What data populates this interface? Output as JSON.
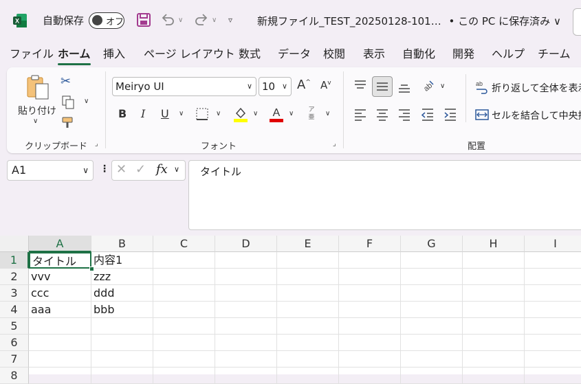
{
  "titlebar": {
    "autosave_label": "自動保存",
    "toggle_label": "オフ",
    "doc_title": "新規ファイル_TEST_20250128-101…",
    "save_state": "• この PC に保存済み ∨"
  },
  "menu_tabs": [
    "ファイル",
    "ホーム",
    "挿入",
    "ページ レイアウト",
    "数式",
    "データ",
    "校閲",
    "表示",
    "自動化",
    "開発",
    "ヘルプ",
    "チーム"
  ],
  "ribbon": {
    "clipboard": {
      "paste_label": "貼り付け",
      "group_label": "クリップボード"
    },
    "font": {
      "font_name": "Meiryo UI",
      "font_size": "10",
      "group_label": "フォント",
      "bold": "B",
      "italic": "I",
      "underline": "U",
      "furigana": "ア亜"
    },
    "alignment": {
      "wrap_label": "折り返して全体を表示",
      "merge_label": "セルを結合して中央揃",
      "group_label": "配置"
    }
  },
  "formula_bar": {
    "name_box": "A1",
    "fx": "fx",
    "content": "タイトル"
  },
  "sheet": {
    "columns": [
      "A",
      "B",
      "C",
      "D",
      "E",
      "F",
      "G",
      "H",
      "I"
    ],
    "rows": [
      "1",
      "2",
      "3",
      "4",
      "5",
      "6",
      "7",
      "8"
    ],
    "cells": [
      [
        "タイトル",
        "内容1"
      ],
      [
        "vvv",
        "zzz"
      ],
      [
        "ccc",
        "ddd"
      ],
      [
        "aaa",
        "bbb"
      ]
    ]
  },
  "colors": {
    "excel_green": "#1e7145",
    "highlight_yellow": "#ffff00",
    "font_red": "#e00000"
  }
}
